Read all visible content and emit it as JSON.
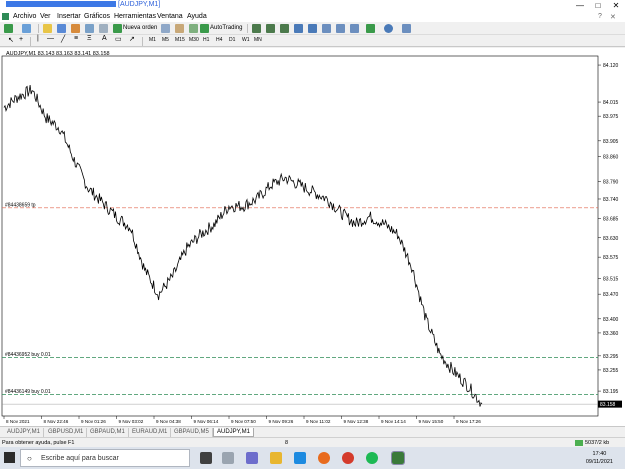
{
  "window": {
    "title_suffix": "[AUDJPY,M1]",
    "minimize": "—",
    "maximize": "□",
    "close": "✕"
  },
  "menu": [
    "Archivo",
    "Ver",
    "Insertar",
    "Gráficos",
    "Herramientas",
    "Ventana",
    "Ayuda"
  ],
  "toolbar": {
    "new_order": "Nueva orden",
    "autotrading": "AutoTrading",
    "timeframes": [
      "M1",
      "M5",
      "M15",
      "M30",
      "H1",
      "H4",
      "D1",
      "W1",
      "MN"
    ]
  },
  "chart": {
    "header": "AUDJPY,M1  83.143 83.163 83.141 83.158",
    "order_labels": [
      "#84438659 tp",
      "#84436952 buy 0.01",
      "#84436149 buy 0.01"
    ],
    "current_price_label": "83.158",
    "price_ticks": [
      "84.120",
      "84.015",
      "83.905",
      "83.790",
      "83.685",
      "83.575",
      "83.470",
      "83.360",
      "83.255",
      "83.150"
    ],
    "mid_ticks": [
      "83.975",
      "83.860",
      "83.740",
      "83.630",
      "83.515",
      "83.400",
      "83.295",
      "83.195"
    ],
    "time_ticks": [
      "8 Nov 2021",
      "8 Nov 22:46",
      "9 Nov 01:26",
      "9 Nov 03:02",
      "9 Nov 04:38",
      "9 Nov 06:14",
      "9 Nov 07:50",
      "9 Nov 09:26",
      "9 Nov 11:02",
      "9 Nov 12:38",
      "9 Nov 14:14",
      "9 Nov 15:50",
      "9 Nov 17:26"
    ],
    "colors": {
      "price_line": "#000000",
      "tp_line": "#e0604a",
      "buy_line": "#2e8b57",
      "current_price_bg": "#000000"
    }
  },
  "chart_data": {
    "type": "line",
    "title": "AUDJPY,M1",
    "x": [
      "8 Nov 2021",
      "8 Nov 22:46",
      "9 Nov 01:26",
      "9 Nov 03:02",
      "9 Nov 04:38",
      "9 Nov 06:14",
      "9 Nov 07:50",
      "9 Nov 09:26",
      "9 Nov 11:02",
      "9 Nov 12:38",
      "9 Nov 14:14",
      "9 Nov 15:50",
      "9 Nov 17:26"
    ],
    "series": [
      {
        "name": "AUDJPY",
        "values": [
          84.0,
          84.03,
          84.05,
          83.97,
          83.94,
          83.85,
          83.77,
          83.73,
          83.69,
          83.66,
          83.54,
          83.47,
          83.52,
          83.6,
          83.64,
          83.67,
          83.72,
          83.72,
          83.74,
          83.78,
          83.8,
          83.78,
          83.76,
          83.74,
          83.7,
          83.67,
          83.69,
          83.67,
          83.64,
          83.55,
          83.4,
          83.3,
          83.25,
          83.21,
          83.158
        ]
      }
    ],
    "ylim": [
      83.13,
      84.14
    ],
    "order_levels": [
      {
        "label": "#84438659 tp",
        "value": 83.715
      },
      {
        "label": "#84436952 buy 0.01",
        "value": 83.29
      },
      {
        "label": "#84436149 buy 0.01",
        "value": 83.185
      }
    ],
    "grid": false
  },
  "tabs": [
    "AUDJPY,M1",
    "GBPUSD,M1",
    "GBPAUD,M1",
    "EURAUD,M1",
    "GBPAUD,M5",
    "AUDJPY,M1"
  ],
  "active_tab_index": 5,
  "status": {
    "help": "Para obtener ayuda, pulse F1",
    "center": "8",
    "traffic": "5037/2 kb"
  },
  "taskbar": {
    "search_placeholder": "Escribe aquí para buscar",
    "time": "17:40",
    "date": "09/11/2021"
  }
}
